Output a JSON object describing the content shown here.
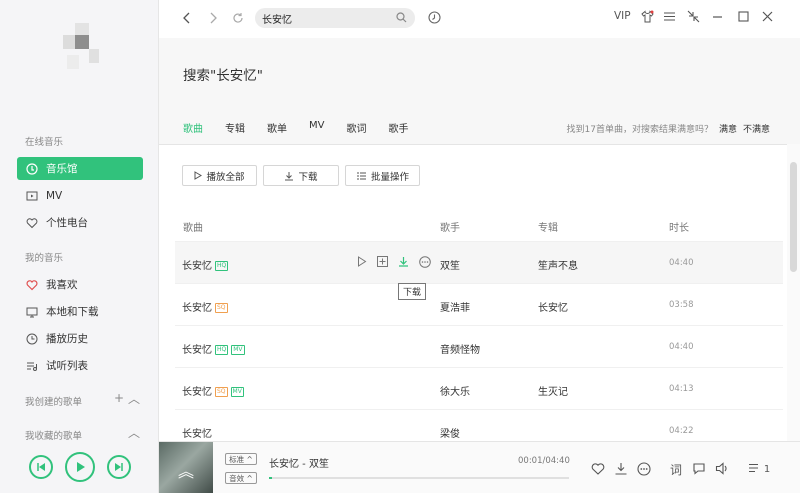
{
  "sidebar": {
    "online_title": "在线音乐",
    "items_online": [
      {
        "label": "音乐馆",
        "active": true
      },
      {
        "label": "MV"
      },
      {
        "label": "个性电台"
      }
    ],
    "my_title": "我的音乐",
    "items_my": [
      {
        "label": "我喜欢"
      },
      {
        "label": "本地和下载"
      },
      {
        "label": "播放历史"
      },
      {
        "label": "试听列表"
      }
    ],
    "created_title": "我创建的歌单",
    "collected_title": "我收藏的歌单"
  },
  "search": {
    "query": "长安忆"
  },
  "topbar": {
    "vip": "VIP"
  },
  "header": {
    "title": "搜索\"长安忆\"",
    "tabs": [
      "歌曲",
      "专辑",
      "歌单",
      "MV",
      "歌词",
      "歌手"
    ],
    "hint": "找到17首单曲，对搜索结果满意吗？",
    "satisfied": "满意",
    "unsatisfied": "不满意"
  },
  "actions": {
    "play_all": "播放全部",
    "download": "下载",
    "batch": "批量操作"
  },
  "table": {
    "headers": {
      "song": "歌曲",
      "singer": "歌手",
      "album": "专辑",
      "duration": "时长"
    },
    "rows": [
      {
        "title": "长安忆",
        "tags": [
          "HQ"
        ],
        "singer": "双笙",
        "album": "笙声不息",
        "duration": "04:40"
      },
      {
        "title": "长安忆",
        "tags": [
          "SQ"
        ],
        "singer": "夏浩菲",
        "album": "长安忆",
        "duration": "03:58"
      },
      {
        "title": "长安忆",
        "tags": [
          "HQ",
          "MV"
        ],
        "singer": "音频怪物",
        "album": "",
        "duration": "04:40"
      },
      {
        "title": "长安忆",
        "tags": [
          "SQ",
          "MV"
        ],
        "singer": "徐大乐",
        "album": "生灭记",
        "duration": "04:13"
      },
      {
        "title": "长安忆",
        "tags": [],
        "singer": "梁俊",
        "album": "",
        "duration": "04:22"
      }
    ],
    "tooltip": "下载"
  },
  "player": {
    "quality": "标准",
    "effect": "音效",
    "now_playing": "长安忆 - 双笙",
    "time": "00:01/04:40",
    "progress": 0.01,
    "playlist_count": "1",
    "lyric": "词"
  },
  "colors": {
    "accent": "#31c27c",
    "sq": "#f0a050"
  }
}
